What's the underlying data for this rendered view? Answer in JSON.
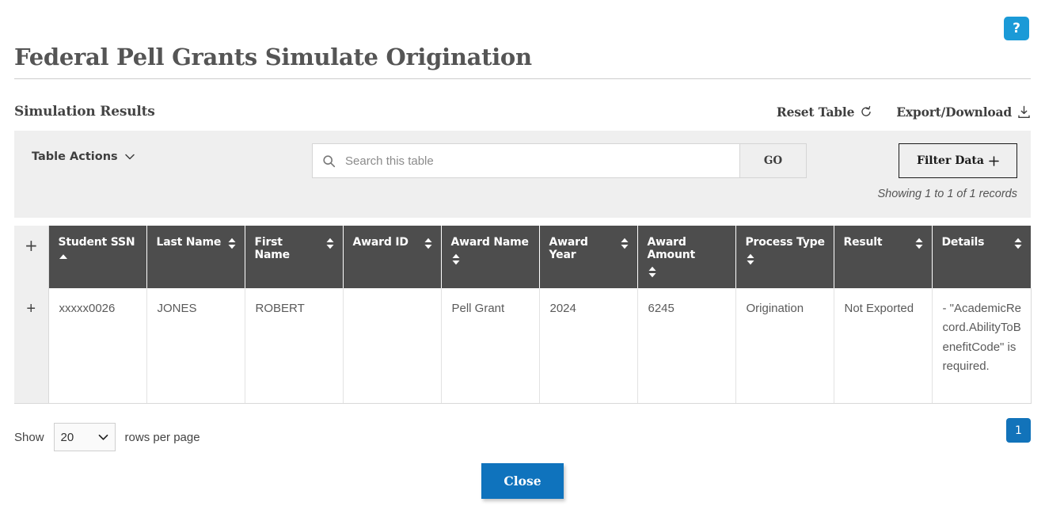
{
  "help": {
    "label": "?",
    "icon": "help-icon",
    "color": "#1b9ad7"
  },
  "header": {
    "title": "Federal Pell Grants Simulate Origination",
    "section_title": "Simulation Results",
    "reset_table_label": "Reset Table",
    "reset_table_icon": "refresh-icon",
    "export_download_label": "Export/Download",
    "export_download_icon": "download-icon"
  },
  "toolbar": {
    "table_actions_label": "Table Actions",
    "table_actions_icon": "chevron-down-icon",
    "search_icon": "search-icon",
    "search_placeholder": "Search this table",
    "search_value": "",
    "go_label": "GO",
    "filter_label": "Filter Data",
    "filter_icon": "plus-icon",
    "records_note": "Showing 1 to 1 of 1 records"
  },
  "table": {
    "expand_icon": "plus-icon",
    "columns": [
      {
        "label": "Student SSN",
        "sort": "asc",
        "wrapped": true
      },
      {
        "label": "Last Name",
        "sort": "none",
        "wrapped": false
      },
      {
        "label": "First Name",
        "sort": "none",
        "wrapped": false
      },
      {
        "label": "Award ID",
        "sort": "none",
        "wrapped": false
      },
      {
        "label": "Award Name",
        "sort": "none",
        "wrapped": true
      },
      {
        "label": "Award Year",
        "sort": "none",
        "wrapped": false
      },
      {
        "label": "Award Amount",
        "sort": "none",
        "wrapped": true
      },
      {
        "label": "Process Type",
        "sort": "none",
        "wrapped": true
      },
      {
        "label": "Result",
        "sort": "none",
        "wrapped": false
      },
      {
        "label": "Details",
        "sort": "none",
        "wrapped": false
      }
    ],
    "rows": [
      {
        "student_ssn": "xxxxx0026",
        "last_name": "JONES",
        "first_name": "ROBERT",
        "award_id": "",
        "award_name": "Pell Grant",
        "award_year": "2024",
        "award_amount": "6245",
        "process_type": "Origination",
        "result": "Not Exported",
        "details": "- \"AcademicRecord.AbilityToBenefitCode\" is required."
      }
    ]
  },
  "footer": {
    "show_label": "Show",
    "rows_per_page_value": "20",
    "rows_per_page_options": [
      "20"
    ],
    "rows_label": "rows per page",
    "current_page": "1",
    "close_label": "Close"
  },
  "colors": {
    "help_blue": "#1b9ad7",
    "accent_blue": "#0f73bd",
    "page_blue": "#1273ba",
    "header_gray": "#4d4d4d",
    "panel_gray": "#efefef"
  }
}
